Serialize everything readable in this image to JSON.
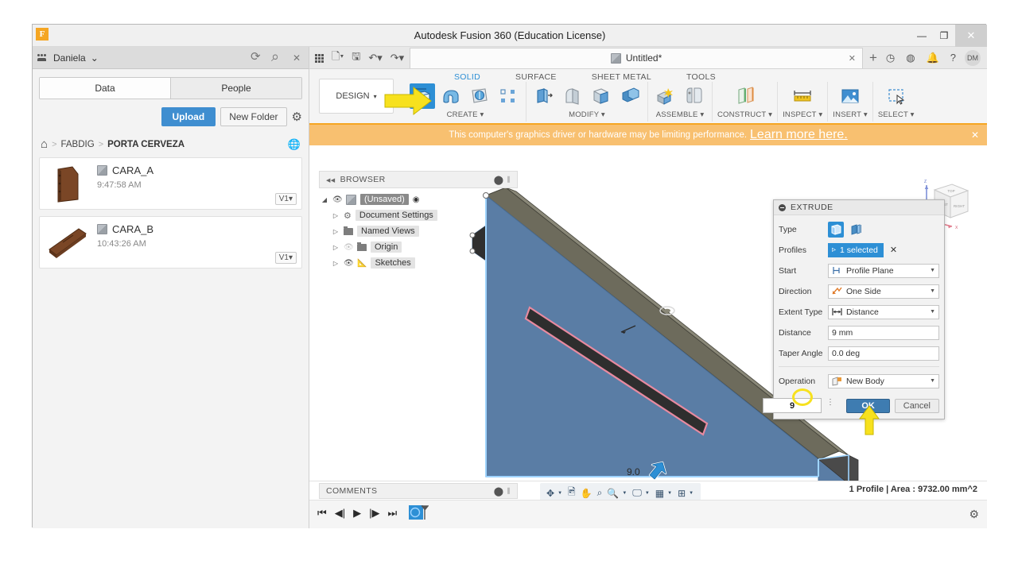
{
  "window": {
    "title": "Autodesk Fusion 360 (Education License)",
    "logo_letter": "F",
    "minimize": "—",
    "maximize": "❐",
    "close": "✕"
  },
  "data_panel": {
    "user_name": "Daniela",
    "user_caret": "⌄",
    "icons": {
      "refresh": "refresh-icon",
      "search": "search-icon",
      "close": "close-icon"
    },
    "tabs": [
      {
        "label": "Data",
        "active": true
      },
      {
        "label": "People",
        "active": false
      }
    ],
    "upload_label": "Upload",
    "new_folder_label": "New Folder",
    "settings_icon": "gear-icon",
    "breadcrumb": {
      "home_icon": "home-icon",
      "items": [
        "FABDIG",
        "PORTA CERVEZA"
      ],
      "separator": ">",
      "globe_icon": "globe-icon"
    },
    "files": [
      {
        "name": "CARA_A",
        "time": "9:47:58 AM",
        "version": "V1"
      },
      {
        "name": "CARA_B",
        "time": "10:43:26 AM",
        "version": "V1"
      }
    ]
  },
  "tab_strip": {
    "doc_tab_label": "Untitled*",
    "doc_tab_close": "✕",
    "new_tab": "+",
    "avatar_initials": "DM",
    "left_icons": [
      "apps-grid-icon",
      "new-file-icon",
      "save-icon",
      "undo-icon",
      "redo-icon"
    ],
    "right_icons": [
      "job-status-icon",
      "recent-icon",
      "notifications-icon",
      "help-icon"
    ]
  },
  "ribbon": {
    "workspace_label": "DESIGN",
    "workspace_caret": "▾",
    "tabs": [
      {
        "label": "SOLID",
        "active": true
      },
      {
        "label": "SURFACE",
        "active": false
      },
      {
        "label": "SHEET METAL",
        "active": false
      },
      {
        "label": "TOOLS",
        "active": false
      }
    ],
    "groups": [
      {
        "label": "CREATE ▾",
        "icons": [
          "extrude-icon",
          "revolve-icon",
          "sweep-icon",
          "pattern-icon"
        ]
      },
      {
        "label": "MODIFY ▾",
        "icons": [
          "press-pull-icon",
          "fillet-icon",
          "shell-icon",
          "combine-icon"
        ]
      },
      {
        "label": "ASSEMBLE ▾",
        "icons": [
          "new-component-icon",
          "joint-icon"
        ]
      },
      {
        "label": "CONSTRUCT ▾",
        "icons": [
          "offset-plane-icon"
        ]
      },
      {
        "label": "INSPECT ▾",
        "icons": [
          "measure-icon"
        ]
      },
      {
        "label": "INSERT ▾",
        "icons": [
          "insert-image-icon"
        ]
      },
      {
        "label": "SELECT ▾",
        "icons": [
          "select-window-icon"
        ]
      }
    ]
  },
  "banner": {
    "message": "This computer's graphics driver or hardware may be limiting performance.",
    "link_text": "Learn more here.",
    "close": "✕"
  },
  "browser": {
    "header": "BROWSER",
    "collapse_icon": "collapse-icon",
    "nodes": [
      {
        "label": "(Unsaved)",
        "root": true,
        "eye": true
      },
      {
        "label": "Document Settings",
        "root": false,
        "eye": false,
        "icon": "gear-icon"
      },
      {
        "label": "Named Views",
        "root": false,
        "eye": false,
        "icon": "folder-icon"
      },
      {
        "label": "Origin",
        "root": false,
        "eye": false,
        "icon": "folder-icon",
        "dim": true
      },
      {
        "label": "Sketches",
        "root": false,
        "eye": true,
        "icon": "sketch-icon"
      }
    ]
  },
  "viewport": {
    "dimension_label": "9.0",
    "viewcube": {
      "front": "FRONT",
      "right": "RIGHT",
      "top": "TOP",
      "z_axis": "Z",
      "x_axis": "X"
    }
  },
  "extrude_dialog": {
    "title": "EXTRUDE",
    "rows": [
      {
        "label": "Type",
        "kind": "chips"
      },
      {
        "label": "Profiles",
        "kind": "selection",
        "value": "1 selected",
        "clear": "✕"
      },
      {
        "label": "Start",
        "kind": "select",
        "value": "Profile Plane"
      },
      {
        "label": "Direction",
        "kind": "select",
        "value": "One Side"
      },
      {
        "label": "Extent Type",
        "kind": "select",
        "value": "Distance"
      },
      {
        "label": "Distance",
        "kind": "input",
        "value": "9 mm"
      },
      {
        "label": "Taper Angle",
        "kind": "input",
        "value": "0.0 deg"
      },
      {
        "label": "Operation",
        "kind": "select",
        "value": "New Body"
      }
    ],
    "inline_value": "9",
    "ok_label": "OK",
    "cancel_label": "Cancel"
  },
  "status_bar": {
    "comments_label": "COMMENTS",
    "status_text": "1 Profile | Area : 9732.00 mm^2",
    "nav_tools": [
      "orbit-icon",
      "look-at-icon",
      "pan-icon",
      "zoom-icon",
      "zoom-window-icon",
      "display-settings-icon",
      "grid-icon",
      "viewports-icon"
    ]
  },
  "timeline": {
    "controls": [
      "go-to-beginning-icon",
      "step-back-icon",
      "play-icon",
      "step-forward-icon",
      "go-to-end-icon"
    ],
    "marker": "sketch-feature-icon",
    "settings_icon": "gear-icon"
  },
  "colors": {
    "accent_blue": "#2d8fd5",
    "ok_blue": "#3e7cb1",
    "banner_orange": "#f8c070",
    "highlight_yellow": "#f7e11e",
    "model_face": "#5a7da5",
    "profile_pink": "#e88aa0"
  }
}
